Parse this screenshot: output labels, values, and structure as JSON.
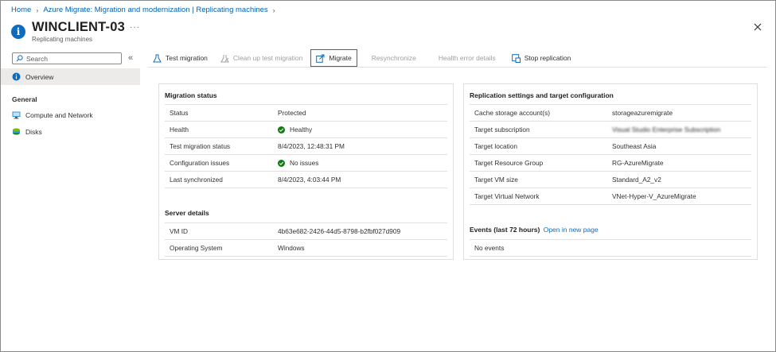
{
  "breadcrumb": {
    "home": "Home",
    "parent": "Azure Migrate: Migration and modernization | Replicating machines"
  },
  "header": {
    "title": "WINCLIENT-03",
    "subtitle": "Replicating machines",
    "more": "···"
  },
  "search": {
    "placeholder": "Search"
  },
  "sidebar": {
    "collapse": "«",
    "overview": "Overview",
    "group": "General",
    "items": [
      {
        "label": "Compute and Network",
        "icon": "monitor-icon"
      },
      {
        "label": "Disks",
        "icon": "disks-icon"
      }
    ]
  },
  "toolbar": {
    "test_migration": "Test migration",
    "cleanup": "Clean up test migration",
    "migrate": "Migrate",
    "resync": "Resynchronize",
    "health_details": "Health error details",
    "stop": "Stop replication"
  },
  "migration_status": {
    "title": "Migration status",
    "rows": [
      {
        "label": "Status",
        "value": "Protected"
      },
      {
        "label": "Health",
        "value": "Healthy"
      },
      {
        "label": "Test migration status",
        "value": "8/4/2023, 12:48:31 PM"
      },
      {
        "label": "Configuration issues",
        "value": "No issues"
      },
      {
        "label": "Last synchronized",
        "value": "8/4/2023, 4:03:44 PM"
      }
    ]
  },
  "server_details": {
    "title": "Server details",
    "rows": [
      {
        "label": "VM ID",
        "value": "4b63e682-2426-44d5-8798-b2fbf027d909"
      },
      {
        "label": "Operating System",
        "value": "Windows"
      }
    ]
  },
  "replication": {
    "title": "Replication settings and target configuration",
    "rows": [
      {
        "label": "Cache storage account(s)",
        "value": "storageazuremigrate"
      },
      {
        "label": "Target subscription",
        "value": "Visual Studio Enterprise Subscription"
      },
      {
        "label": "Target location",
        "value": "Southeast Asia"
      },
      {
        "label": "Target Resource Group",
        "value": "RG-AzureMigrate"
      },
      {
        "label": "Target VM size",
        "value": "Standard_A2_v2"
      },
      {
        "label": "Target Virtual Network",
        "value": "VNet-Hyper-V_AzureMigrate"
      }
    ]
  },
  "events": {
    "title": "Events (last 72 hours)",
    "link": "Open in new page",
    "empty": "No events"
  },
  "colors": {
    "accent": "#0f6cbd",
    "success": "#107c10"
  }
}
